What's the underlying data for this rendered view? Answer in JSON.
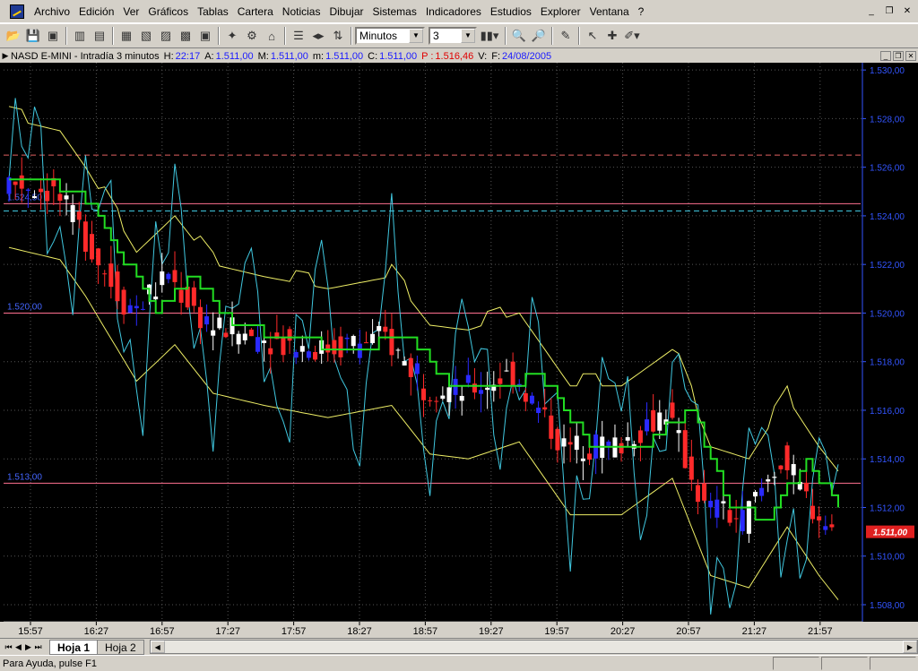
{
  "menu": {
    "items": [
      "Archivo",
      "Edición",
      "Ver",
      "Gráficos",
      "Tablas",
      "Cartera",
      "Noticias",
      "Dibujar",
      "Sistemas",
      "Indicadores",
      "Estudios",
      "Explorer",
      "Ventana",
      "?"
    ]
  },
  "toolbar": {
    "timeframe_value": "Minutos",
    "interval_value": "3"
  },
  "chart": {
    "header": {
      "symbol": "NASD E-MINI - Intradía 3 minutos",
      "h_label": "H:",
      "h_value": "22:17",
      "a_label": "A:",
      "a_value": "1.511,00",
      "m_label": "M:",
      "m_value": "1.511,00",
      "mn_label": "m:",
      "mn_value": "1.511,00",
      "c_label": "C:",
      "c_value": "1.511,00",
      "p_label": "P :",
      "p_value": "1.516,46",
      "v_label": "V:",
      "f_label": "F:",
      "f_value": "24/08/2005"
    }
  },
  "chart_data": {
    "type": "candlestick",
    "x_tick_labels": [
      "15:57",
      "16:27",
      "16:57",
      "17:27",
      "17:57",
      "18:27",
      "18:57",
      "19:27",
      "19:57",
      "20:27",
      "20:57",
      "21:27",
      "21:57"
    ],
    "y_tick_labels": [
      "1.530,00",
      "1.528,00",
      "1.526,00",
      "1.524,00",
      "1.522,00",
      "1.520,00",
      "1.518,00",
      "1.516,00",
      "1.514,00",
      "1.512,00",
      "1.510,00",
      "1.508,00"
    ],
    "y_ticks": [
      1530,
      1528,
      1526,
      1524,
      1522,
      1520,
      1518,
      1516,
      1514,
      1512,
      1510,
      1508
    ],
    "ylim": [
      1507.3,
      1530.3
    ],
    "last_price_label": "1.511,00",
    "last_price": 1511.0,
    "level_labels": [
      {
        "price": 1524.5,
        "text": "1.524,50"
      },
      {
        "price": 1520.0,
        "text": "1.520,00"
      },
      {
        "price": 1513.0,
        "text": "1.513,00"
      }
    ],
    "extra_levels": [
      {
        "price": 1526.5,
        "style": "dashed",
        "color": "#e06060"
      },
      {
        "price": 1524.2,
        "style": "dashed",
        "color": "#40c8e0"
      }
    ],
    "colors": {
      "up_candle": "#ffffff",
      "down_candle": "#ff2a2a",
      "blue_candle": "#2a2aff",
      "ma_line": "#22dd22",
      "channel_line": "#eeee66",
      "oscillator_line": "#40c8e0",
      "grid": "#555555",
      "axis_text": "#3355ff"
    }
  }
}
